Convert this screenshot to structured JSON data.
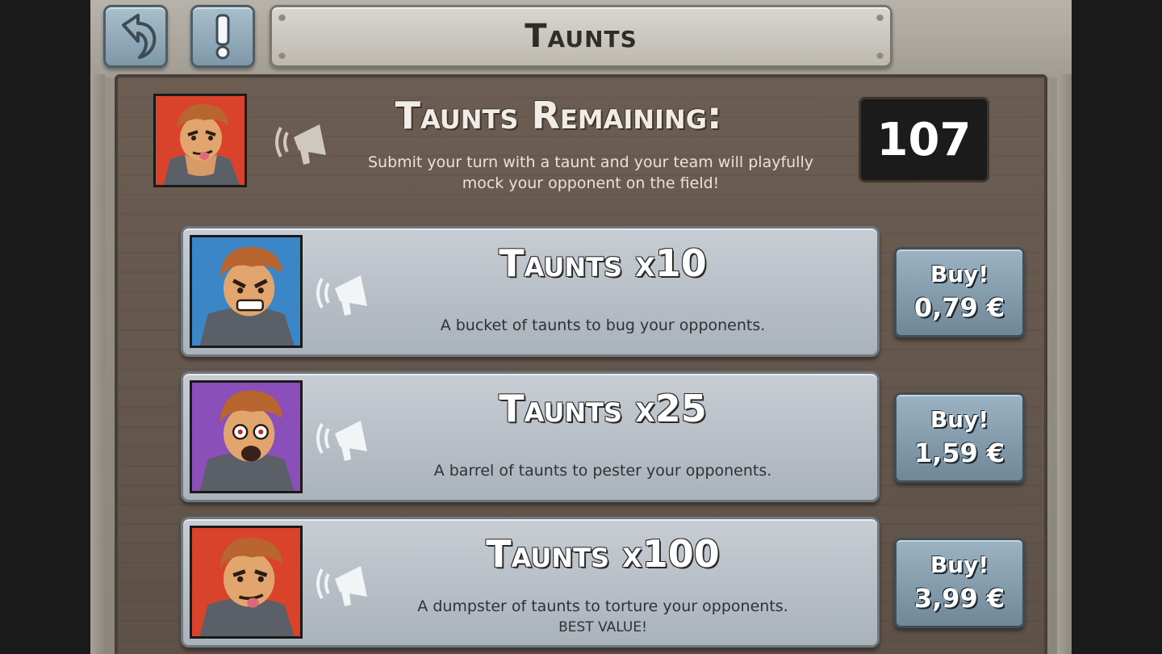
{
  "header": {
    "title": "Taunts",
    "back_icon": "back-arrow-icon",
    "info_icon": "exclamation-icon"
  },
  "summary": {
    "title": "Taunts Remaining:",
    "description_line1": "Submit your turn with a taunt and your team will playfully",
    "description_line2": "mock your opponent on the field!",
    "count": "107",
    "portrait_bg": "#d9432c"
  },
  "offers": [
    {
      "title": "Taunts x10",
      "description": "A bucket of taunts to bug your opponents.",
      "note": "",
      "buy_label": "Buy!",
      "price": "0,79 €",
      "portrait_bg": "#3a86c6"
    },
    {
      "title": "Taunts x25",
      "description": "A barrel of taunts to pester your opponents.",
      "note": "",
      "buy_label": "Buy!",
      "price": "1,59 €",
      "portrait_bg": "#8a4fb8"
    },
    {
      "title": "Taunts x100",
      "description": "A dumpster of taunts to torture your opponents.",
      "note": "BEST VALUE!",
      "buy_label": "Buy!",
      "price": "3,99 €",
      "portrait_bg": "#d9432c"
    }
  ],
  "colors": {
    "wood": "#62554b",
    "plate": "#c4c9cf",
    "button": "#859dac"
  }
}
